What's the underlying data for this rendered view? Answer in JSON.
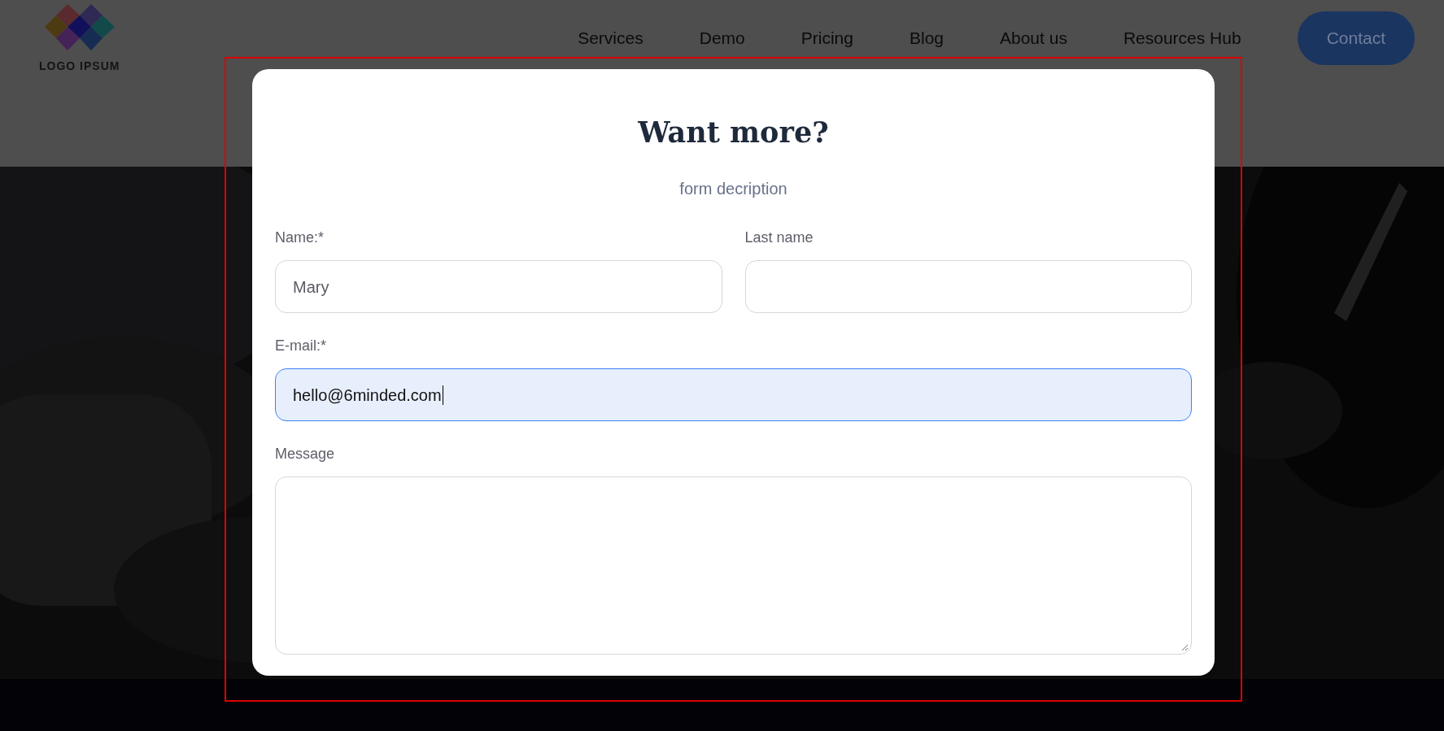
{
  "header": {
    "logo": {
      "text": "LOGO IPSUM"
    },
    "nav": [
      {
        "label": "Services"
      },
      {
        "label": "Demo"
      },
      {
        "label": "Pricing"
      },
      {
        "label": "Blog"
      },
      {
        "label": "About us"
      },
      {
        "label": "Resources Hub"
      }
    ],
    "contact_button": "Contact"
  },
  "modal": {
    "title": "Want more?",
    "description": "form decription",
    "rows": [
      [
        {
          "kind": "input",
          "label": "Name:*",
          "value": "Mary",
          "focused": false
        },
        {
          "kind": "input",
          "label": "Last name",
          "focused": false
        }
      ],
      [
        {
          "kind": "input",
          "label": "E-mail:*",
          "value": "hello@6minded.com",
          "focused": true
        }
      ],
      [
        {
          "kind": "textarea",
          "label": "Message",
          "focused": false
        }
      ]
    ]
  }
}
